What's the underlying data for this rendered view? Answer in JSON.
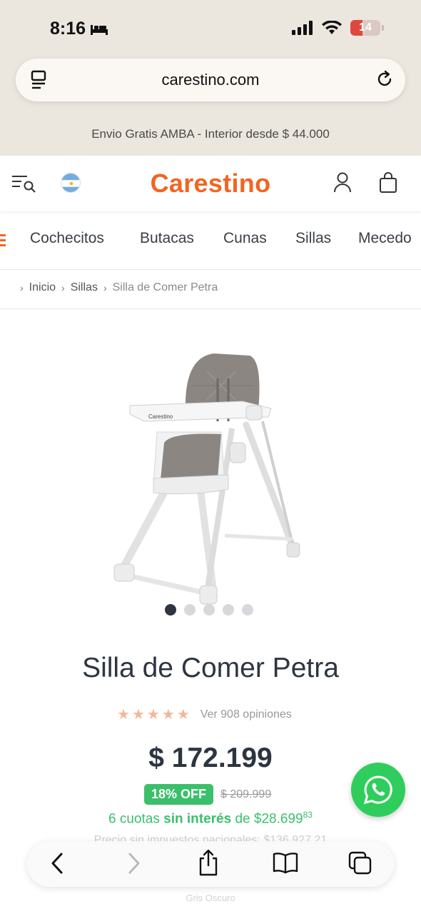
{
  "status": {
    "time": "8:16",
    "battery": "14"
  },
  "browser": {
    "url": "carestino.com"
  },
  "promo": {
    "text": "Envio Gratis AMBA - Interior desde $ 44.000"
  },
  "header": {
    "logo": "Carestino"
  },
  "categories": [
    "Cochecitos",
    "Butacas",
    "Cunas",
    "Sillas",
    "Mecedo"
  ],
  "breadcrumb": {
    "home": "Inicio",
    "section": "Sillas",
    "current": "Silla de Comer Petra"
  },
  "product": {
    "image_brand_text": "Carestino",
    "title": "Silla de Comer Petra",
    "rating_stars": 5,
    "rating_text": "Ver 908 opiniones",
    "price": "$ 172.199",
    "discount": "18% OFF",
    "old_price": "$ 209.999",
    "installments_prefix": "6 cuotas",
    "installments_bold": "sin interés",
    "installments_mid": "de $28.699",
    "installments_cents": "83",
    "tax_price": "Precio sin impuestos nacionales: $136.927,21",
    "color": "Gris Oscuro",
    "carousel_total": 5,
    "carousel_active": 1
  },
  "colors": {
    "accent": "#f26522",
    "success": "#3bbf6b",
    "whatsapp": "#2fce5c",
    "text": "#2d3540"
  }
}
